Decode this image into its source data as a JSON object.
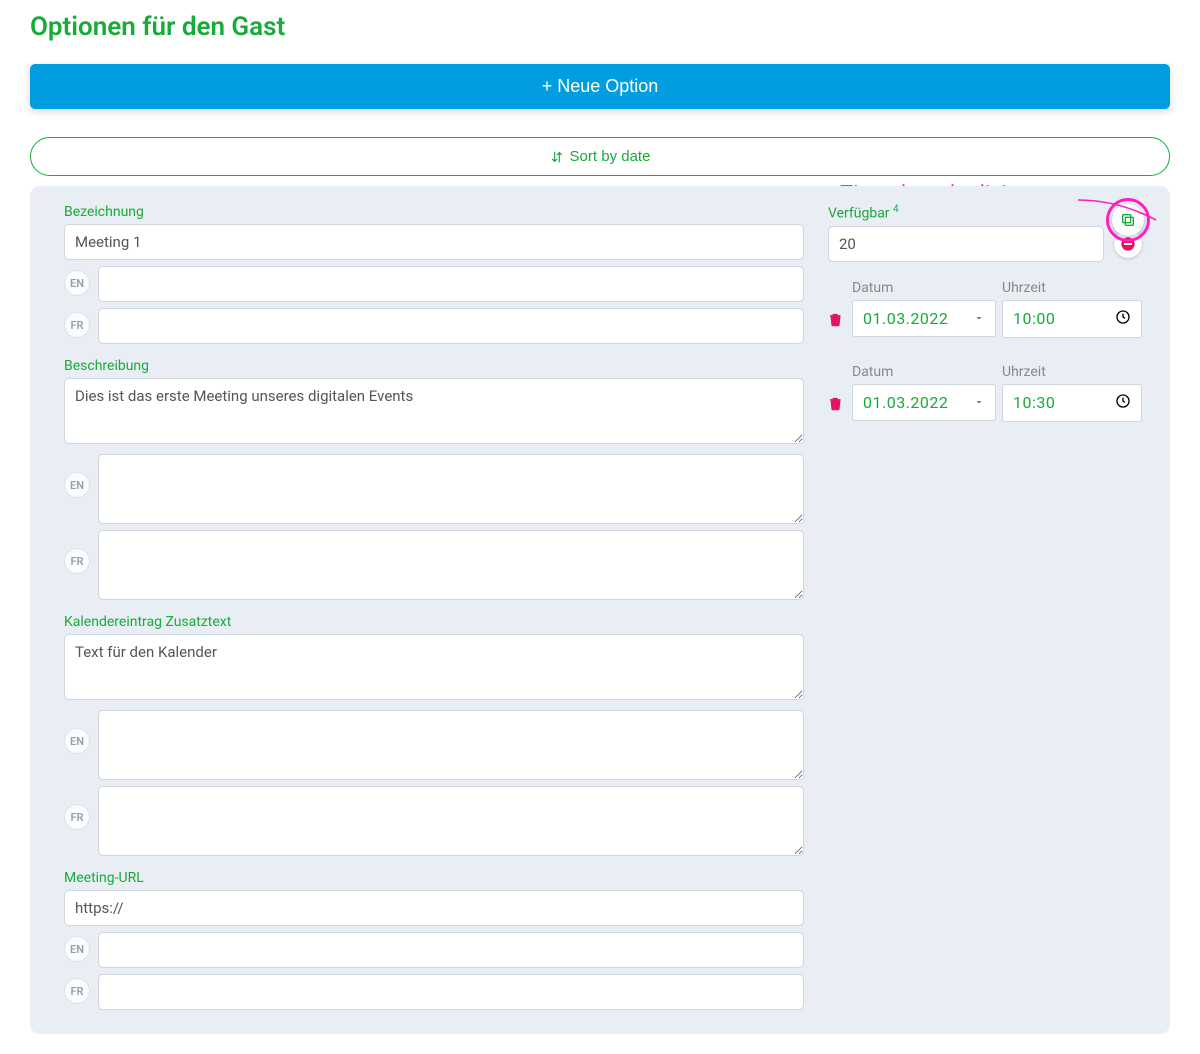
{
  "title": "Optionen für den Gast",
  "buttons": {
    "new_option": "+ Neue Option",
    "sort_by_date": "Sort by date"
  },
  "annotation": "Timeslots duplizieren",
  "labels": {
    "bezeichnung": "Bezeichnung",
    "beschreibung": "Beschreibung",
    "kalender": "Kalendereintrag Zusatztext",
    "meeting_url": "Meeting-URL",
    "verfuegbar": "Verfügbar",
    "verfuegbar_sup": "4",
    "datum": "Datum",
    "uhrzeit": "Uhrzeit"
  },
  "lang": {
    "en": "EN",
    "fr": "FR"
  },
  "option": {
    "name": "Meeting 1",
    "name_en": "",
    "name_fr": "",
    "description": "Dies ist das erste Meeting unseres digitalen Events",
    "description_en": "",
    "description_fr": "",
    "calendar_text": "Text für den Kalender",
    "calendar_text_en": "",
    "calendar_text_fr": "",
    "meeting_url": "https://",
    "meeting_url_en": "",
    "meeting_url_fr": "",
    "available": "20",
    "slots": [
      {
        "date": "01.03.2022",
        "time": "10:00"
      },
      {
        "date": "01.03.2022",
        "time": "10:30"
      }
    ]
  }
}
